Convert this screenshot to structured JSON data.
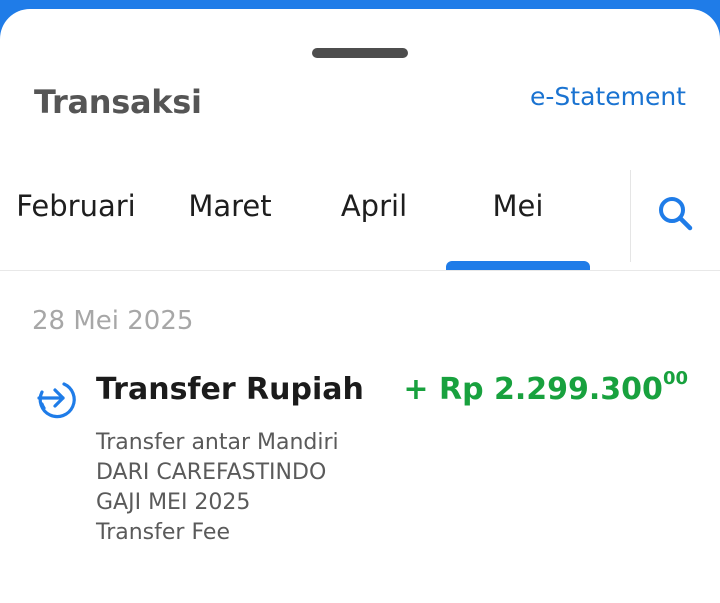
{
  "header": {
    "title": "Transaksi",
    "estatement_label": "e-Statement"
  },
  "tabs": [
    {
      "label": "Februari",
      "active": false
    },
    {
      "label": "Maret",
      "active": false
    },
    {
      "label": "April",
      "active": false
    },
    {
      "label": "Mei",
      "active": true
    }
  ],
  "icons": {
    "search": "search-icon",
    "transfer_in": "arrow-right-circle-icon"
  },
  "transactions": {
    "date": "28 Mei 2025",
    "items": [
      {
        "title": "Transfer Rupiah",
        "amount_main": "+ Rp 2.299.300",
        "amount_cents": "00",
        "description": [
          "Transfer antar Mandiri",
          "DARI CAREFASTINDO",
          "GAJI MEI 2025",
          "Transfer Fee"
        ]
      }
    ]
  },
  "colors": {
    "accent": "#1f7ce8",
    "link": "#1a73d1",
    "credit": "#18a13e",
    "title": "#555555"
  }
}
